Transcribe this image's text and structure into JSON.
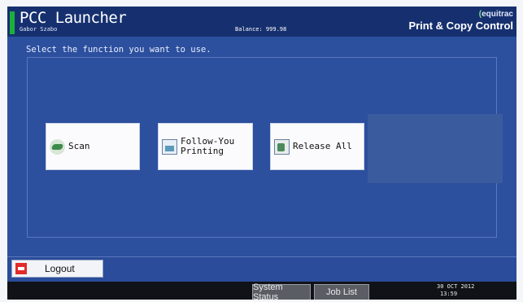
{
  "header": {
    "app_title": "PCC Launcher",
    "user_name": "Gabor Szabo",
    "balance": "Balance: 999.98",
    "brand_logo": "equitrac",
    "brand_tagline": "Print & Copy Control"
  },
  "main": {
    "instruction": "Select the function you want to use.",
    "functions": [
      {
        "label": "Scan",
        "icon": "scan-icon"
      },
      {
        "label": "Follow-You\nPrinting",
        "icon": "document-print-icon"
      },
      {
        "label": "Release All",
        "icon": "release-all-icon"
      }
    ]
  },
  "footer": {
    "logout_label": "Logout",
    "system_status_label": "System Status",
    "job_list_label": "Job List",
    "date": "30 OCT  2012",
    "time": "13:59"
  },
  "colors": {
    "header_bg": "#16306f",
    "screen_bg": "#2c4f9e",
    "accent_green": "#1bb03b",
    "logout_red": "#e22b2b"
  }
}
